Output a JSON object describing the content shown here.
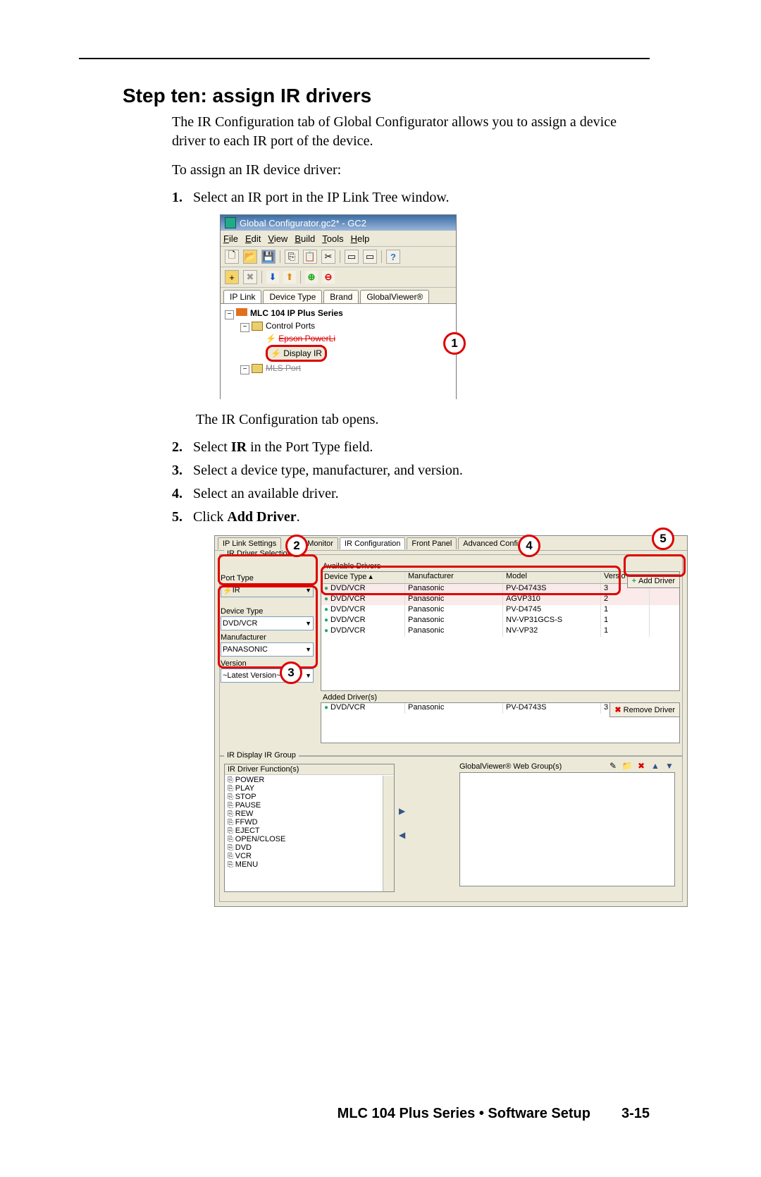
{
  "page": {
    "title": "Step ten: assign IR drivers",
    "intro": "The IR Configuration tab of Global Configurator allows you to assign a device driver to each IR port of the device.",
    "lead": "To assign an IR device driver:",
    "steps": [
      "Select an IR port in the IP Link Tree window.",
      "The IR Configuration tab opens.",
      "Select IR in the Port Type field.",
      "Select a device type, manufacturer, and version.",
      "Select an available driver.",
      "Click Add Driver."
    ],
    "step2_prefix": "Select ",
    "step2_bold": "IR",
    "step2_suffix": " in the Port Type field.",
    "step5_prefix": "Click ",
    "step5_bold": "Add Driver",
    "step5_suffix": "."
  },
  "shot1": {
    "title": "Global Configurator.gc2* - GC2",
    "menus": [
      "File",
      "Edit",
      "View",
      "Build",
      "Tools",
      "Help"
    ],
    "tabs": [
      "IP Link",
      "Device Type",
      "Brand",
      "GlobalViewer®"
    ],
    "tree": {
      "root": "MLC 104 IP Plus Series",
      "control_ports": "Control Ports",
      "epson": "Epson PowerLi",
      "display_ir": "Display IR",
      "mls": "MLS Port"
    },
    "callout": "1"
  },
  "shot2": {
    "tabs": [
      "IP Link Settings",
      "Monitor",
      "IR Configuration",
      "Front Panel",
      "Advanced Configur"
    ],
    "driver_selection": "IR Driver Selection",
    "port_type_label": "Port Type",
    "port_type_value": "IR",
    "device_type_label": "Device Type",
    "device_type_value": "DVD/VCR",
    "manufacturer_label": "Manufacturer",
    "manufacturer_value": "PANASONIC",
    "version_label": "Version",
    "version_value": "~Latest Version~",
    "available_label": "Available Drivers",
    "added_label": "Added Driver(s)",
    "add_driver": "Add Driver",
    "remove_driver": "Remove Driver",
    "cols": [
      "Device Type",
      "Manufacturer",
      "Model",
      "Versio"
    ],
    "rows": [
      {
        "dt": "DVD/VCR",
        "mf": "Panasonic",
        "md": "PV-D4743S",
        "v": "3"
      },
      {
        "dt": "DVD/VCR",
        "mf": "Panasonic",
        "md": "AGVP310",
        "v": "2"
      },
      {
        "dt": "DVD/VCR",
        "mf": "Panasonic",
        "md": "PV-D4745",
        "v": "1"
      },
      {
        "dt": "DVD/VCR",
        "mf": "Panasonic",
        "md": "NV-VP31GCS-S",
        "v": "1"
      },
      {
        "dt": "DVD/VCR",
        "mf": "Panasonic",
        "md": "NV-VP32",
        "v": "1"
      }
    ],
    "added_row": {
      "dt": "DVD/VCR",
      "mf": "Panasonic",
      "md": "PV-D4743S",
      "v": "3"
    },
    "ir_group": "IR Display IR Group",
    "funcs_label": "IR Driver Function(s)",
    "funcs": [
      "POWER",
      "PLAY",
      "STOP",
      "PAUSE",
      "REW",
      "FFWD",
      "EJECT",
      "OPEN/CLOSE",
      "DVD",
      "VCR",
      "MENU"
    ],
    "gv_label": "GlobalViewer® Web Group(s)",
    "callouts": {
      "c2": "2",
      "c3": "3",
      "c4": "4",
      "c5": "5"
    }
  },
  "footer": {
    "text": "MLC 104 Plus Series • Software Setup",
    "page": "3-15"
  }
}
